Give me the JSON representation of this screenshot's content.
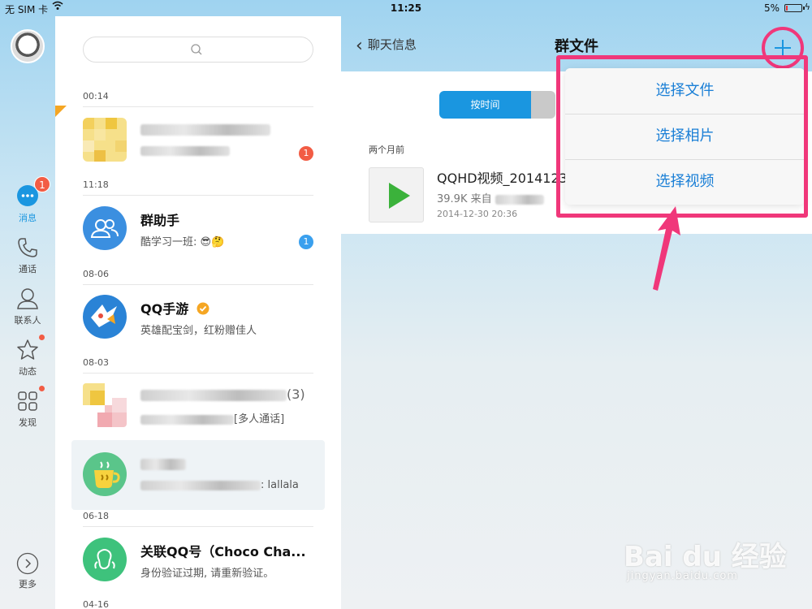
{
  "status_bar": {
    "carrier": "无 SIM 卡",
    "time": "11:25",
    "battery": "5%"
  },
  "sidebar": {
    "items": [
      {
        "label": "消息",
        "icon": "chat-bubble-icon",
        "badge": "1"
      },
      {
        "label": "通话",
        "icon": "phone-icon"
      },
      {
        "label": "联系人",
        "icon": "contact-icon"
      },
      {
        "label": "动态",
        "icon": "star-icon"
      },
      {
        "label": "发现",
        "icon": "grid-icon"
      }
    ],
    "more_label": "更多"
  },
  "search": {
    "placeholder": ""
  },
  "conversations": {
    "dates": [
      "00:14",
      "11:18",
      "08-06",
      "08-03",
      "06-18",
      "04-16"
    ],
    "items": [
      {
        "name": "",
        "message": "",
        "badge": "1"
      },
      {
        "name": "群助手",
        "message": "酷学习一班: 😎🤔",
        "badge": "1"
      },
      {
        "name": "QQ手游",
        "message": "英雄配宝剑，红粉赠佳人"
      },
      {
        "name": "(3)",
        "message": "[多人通话]"
      },
      {
        "name": "",
        "message": ": lallala"
      },
      {
        "name": "关联QQ号（Choco Cha...",
        "message": "身份验证过期, 请重新验证。"
      }
    ]
  },
  "detail": {
    "back_label": "聊天信息",
    "title": "群文件",
    "segment_active": "按时间",
    "group_label": "两个月前",
    "file": {
      "name": "QQHD视频_2014123",
      "size": "39.9K 来自",
      "date": "2014-12-30 20:36"
    }
  },
  "menu": {
    "options": [
      "选择文件",
      "选择相片",
      "选择视频"
    ]
  },
  "watermark": {
    "brand": "Bai du 经验",
    "url": "jingyan.baidu.com"
  },
  "colors": {
    "accent": "#1a96e0",
    "badge_red": "#f25c44",
    "badge_blue": "#3aa0ee",
    "highlight": "#f0377a"
  }
}
